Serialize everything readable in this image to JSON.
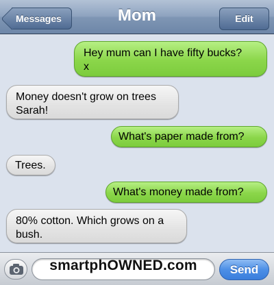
{
  "nav": {
    "back_label": "Messages",
    "title": "Mom",
    "edit_label": "Edit"
  },
  "messages": [
    {
      "direction": "outgoing",
      "text": "Hey mum can I have fifty bucks?\nx"
    },
    {
      "direction": "incoming",
      "text": "Money doesn't grow on trees\nSarah!"
    },
    {
      "direction": "outgoing",
      "text": "What's paper made from?"
    },
    {
      "direction": "incoming",
      "text": "Trees."
    },
    {
      "direction": "outgoing",
      "text": "What's money made from?"
    },
    {
      "direction": "incoming",
      "text": "80% cotton. Which grows on a\nbush."
    }
  ],
  "input": {
    "brand_text": "smartphOWNED.com",
    "send_label": "Send"
  },
  "colors": {
    "outgoing_bubble": "#8bd64a",
    "incoming_bubble": "#e3e3e3",
    "send_button": "#4d8fe6",
    "nav_bar": "#8ea3bf"
  },
  "icons": {
    "camera": "camera-icon",
    "back": "back-arrow-icon"
  }
}
